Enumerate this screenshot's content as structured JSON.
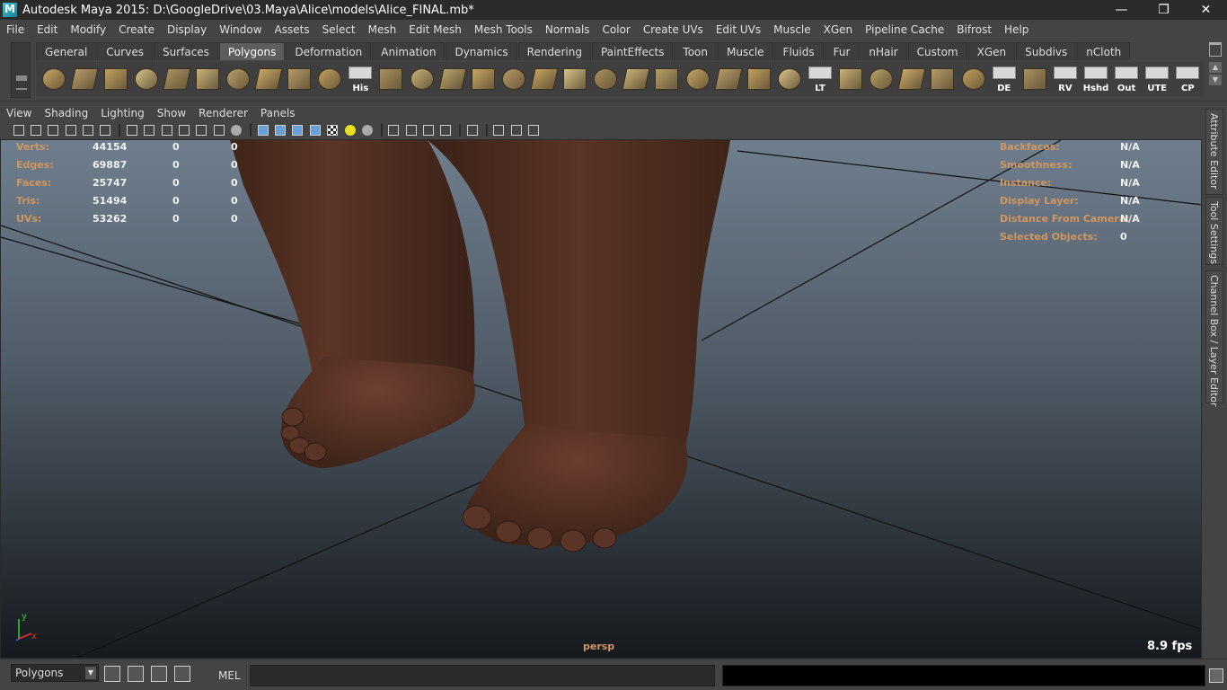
{
  "window": {
    "title": "Autodesk Maya 2015: D:\\GoogleDrive\\03.Maya\\Alice\\models\\Alice_FINAL.mb*",
    "minimize": "—",
    "restore": "❐",
    "close": "✕"
  },
  "menubar": [
    "File",
    "Edit",
    "Modify",
    "Create",
    "Display",
    "Window",
    "Assets",
    "Select",
    "Mesh",
    "Edit Mesh",
    "Mesh Tools",
    "Normals",
    "Color",
    "Create UVs",
    "Edit UVs",
    "Muscle",
    "XGen",
    "Pipeline Cache",
    "Bifrost",
    "Help"
  ],
  "shelf": {
    "tabs": [
      "General",
      "Curves",
      "Surfaces",
      "Polygons",
      "Deformation",
      "Animation",
      "Dynamics",
      "Rendering",
      "PaintEffects",
      "Toon",
      "Muscle",
      "Fluids",
      "Fur",
      "nHair",
      "Custom",
      "XGen",
      "Subdivs",
      "nCloth"
    ],
    "active_tab": "Polygons",
    "icons": [
      {
        "name": "poly-sphere-icon",
        "label": ""
      },
      {
        "name": "poly-cube-icon",
        "label": ""
      },
      {
        "name": "poly-cylinder-icon",
        "label": ""
      },
      {
        "name": "poly-cone-icon",
        "label": ""
      },
      {
        "name": "poly-plane-icon",
        "label": ""
      },
      {
        "name": "poly-torus-icon",
        "label": ""
      },
      {
        "name": "poly-pyramid-icon",
        "label": ""
      },
      {
        "name": "poly-pipe-icon",
        "label": ""
      },
      {
        "name": "poly-helix-icon",
        "label": ""
      },
      {
        "name": "poly-soccer-ball-icon",
        "label": ""
      },
      {
        "name": "history-icon",
        "label": "His"
      },
      {
        "name": "combine-icon",
        "label": ""
      },
      {
        "name": "separate-icon",
        "label": ""
      },
      {
        "name": "extract-icon",
        "label": ""
      },
      {
        "name": "extrude-icon",
        "label": ""
      },
      {
        "name": "bridge-icon",
        "label": ""
      },
      {
        "name": "append-polygon-icon",
        "label": ""
      },
      {
        "name": "split-polygon-icon",
        "label": ""
      },
      {
        "name": "insert-edge-loop-icon",
        "label": ""
      },
      {
        "name": "offset-edge-loop-icon",
        "label": ""
      },
      {
        "name": "sculpt-geometry-icon",
        "label": ""
      },
      {
        "name": "lattice-icon",
        "label": ""
      },
      {
        "name": "soft-mod-icon",
        "label": ""
      },
      {
        "name": "move-tool-icon",
        "label": ""
      },
      {
        "name": "transform-icon",
        "label": ""
      },
      {
        "name": "lt-icon",
        "label": "LT"
      },
      {
        "name": "uv-planar-icon",
        "label": ""
      },
      {
        "name": "uv-cylindrical-icon",
        "label": ""
      },
      {
        "name": "uv-spherical-icon",
        "label": ""
      },
      {
        "name": "uv-automatic-icon",
        "label": ""
      },
      {
        "name": "uv-editor-icon",
        "label": ""
      },
      {
        "name": "de-icon",
        "label": "DE"
      },
      {
        "name": "grid-icon",
        "label": ""
      },
      {
        "name": "rv-icon",
        "label": "RV"
      },
      {
        "name": "hshd-icon",
        "label": "Hshd"
      },
      {
        "name": "out-icon",
        "label": "Out"
      },
      {
        "name": "ute-icon",
        "label": "UTE"
      },
      {
        "name": "cp-icon",
        "label": "CP"
      }
    ]
  },
  "panel": {
    "menu": [
      "View",
      "Shading",
      "Lighting",
      "Show",
      "Renderer",
      "Panels"
    ]
  },
  "viewport": {
    "camera": "persp",
    "fps": "8.9 fps",
    "hud_left": [
      {
        "label": "Verts:",
        "values": [
          "44154",
          "0",
          "0"
        ]
      },
      {
        "label": "Edges:",
        "values": [
          "69887",
          "0",
          "0"
        ]
      },
      {
        "label": "Faces:",
        "values": [
          "25747",
          "0",
          "0"
        ]
      },
      {
        "label": "Tris:",
        "values": [
          "51494",
          "0",
          "0"
        ]
      },
      {
        "label": "UVs:",
        "values": [
          "53262",
          "0",
          "0"
        ]
      }
    ],
    "hud_right": [
      {
        "label": "Backfaces:",
        "value": "N/A"
      },
      {
        "label": "Smoothness:",
        "value": "N/A"
      },
      {
        "label": "Instance:",
        "value": "N/A"
      },
      {
        "label": "Display Layer:",
        "value": "N/A"
      },
      {
        "label": "Distance From Camera:",
        "value": "N/A"
      },
      {
        "label": "Selected Objects:",
        "value": "0"
      }
    ],
    "axis_y": "y",
    "axis_x": "x",
    "colors": {
      "hud_label": "#d09660",
      "skin": "#5a3325"
    }
  },
  "sidetabs": [
    "Attribute Editor",
    "Tool Settings",
    "Channel Box / Layer Editor"
  ],
  "cmdline": {
    "mode": "Polygons",
    "lang": "MEL",
    "input": ""
  }
}
